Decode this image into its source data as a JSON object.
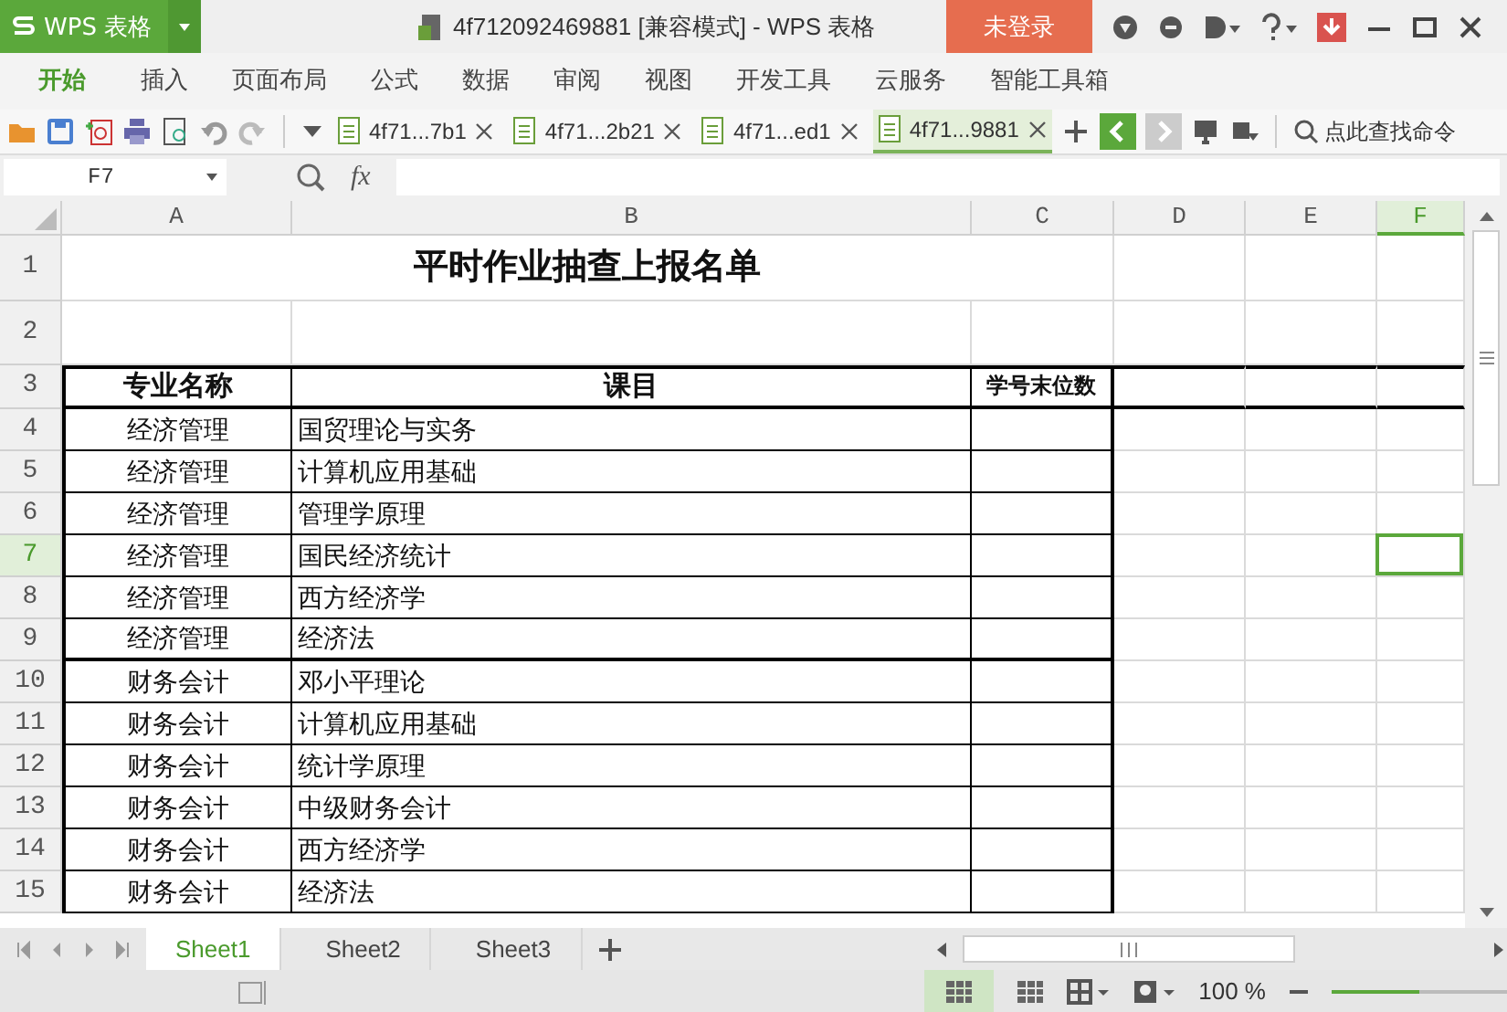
{
  "title_bar": {
    "app_name": "WPS 表格",
    "document_title": "4f712092469881 [兼容模式] - WPS 表格",
    "login_button": "未登录"
  },
  "menu_tabs": [
    {
      "label": "开始",
      "selected": true
    },
    {
      "label": "插入",
      "selected": false
    },
    {
      "label": "页面布局",
      "selected": false
    },
    {
      "label": "公式",
      "selected": false
    },
    {
      "label": "数据",
      "selected": false
    },
    {
      "label": "审阅",
      "selected": false
    },
    {
      "label": "视图",
      "selected": false
    },
    {
      "label": "开发工具",
      "selected": false
    },
    {
      "label": "云服务",
      "selected": false
    },
    {
      "label": "智能工具箱",
      "selected": false
    }
  ],
  "document_tabs": [
    {
      "label": "4f71...7b1",
      "selected": false
    },
    {
      "label": "4f71...2b21",
      "selected": false
    },
    {
      "label": "4f71...ed1",
      "selected": false
    },
    {
      "label": "4f71...9881",
      "selected": true
    }
  ],
  "command_search": {
    "placeholder": "点此查找命令"
  },
  "formula_bar": {
    "name_box": "F7",
    "fx_label": "fx"
  },
  "columns": [
    {
      "label": "A",
      "selected": false
    },
    {
      "label": "B",
      "selected": false
    },
    {
      "label": "C",
      "selected": false
    },
    {
      "label": "D",
      "selected": false
    },
    {
      "label": "E",
      "selected": false
    },
    {
      "label": "F",
      "selected": true
    }
  ],
  "rows": [
    {
      "number": "1",
      "kind": "title",
      "selected": false,
      "cells": [
        "平时作业抽查上报名单"
      ]
    },
    {
      "number": "2",
      "kind": "blank",
      "selected": false,
      "cells": []
    },
    {
      "number": "3",
      "kind": "header",
      "selected": false,
      "cells": [
        "专业名称",
        "课目",
        "学号末位数"
      ]
    },
    {
      "number": "4",
      "kind": "data",
      "selected": false,
      "group_end": false,
      "cells": [
        "经济管理",
        "国贸理论与实务"
      ]
    },
    {
      "number": "5",
      "kind": "data",
      "selected": false,
      "group_end": false,
      "cells": [
        "经济管理",
        "计算机应用基础"
      ]
    },
    {
      "number": "6",
      "kind": "data",
      "selected": false,
      "group_end": false,
      "cells": [
        "经济管理",
        "管理学原理"
      ]
    },
    {
      "number": "7",
      "kind": "data",
      "selected": true,
      "group_end": false,
      "cells": [
        "经济管理",
        "国民经济统计"
      ]
    },
    {
      "number": "8",
      "kind": "data",
      "selected": false,
      "group_end": false,
      "cells": [
        "经济管理",
        "西方经济学"
      ]
    },
    {
      "number": "9",
      "kind": "data",
      "selected": false,
      "group_end": true,
      "cells": [
        "经济管理",
        "经济法"
      ]
    },
    {
      "number": "10",
      "kind": "data",
      "selected": false,
      "group_end": false,
      "cells": [
        "财务会计",
        "邓小平理论"
      ]
    },
    {
      "number": "11",
      "kind": "data",
      "selected": false,
      "group_end": false,
      "cells": [
        "财务会计",
        "计算机应用基础"
      ]
    },
    {
      "number": "12",
      "kind": "data",
      "selected": false,
      "group_end": false,
      "cells": [
        "财务会计",
        "统计学原理"
      ]
    },
    {
      "number": "13",
      "kind": "data",
      "selected": false,
      "group_end": false,
      "cells": [
        "财务会计",
        "中级财务会计"
      ]
    },
    {
      "number": "14",
      "kind": "data",
      "selected": false,
      "group_end": false,
      "cells": [
        "财务会计",
        "西方经济学"
      ]
    },
    {
      "number": "15",
      "kind": "data",
      "selected": false,
      "group_end": false,
      "cells": [
        "财务会计",
        "经济法"
      ]
    }
  ],
  "sheet_tabs": [
    {
      "label": "Sheet1",
      "selected": true
    },
    {
      "label": "Sheet2",
      "selected": false
    },
    {
      "label": "Sheet3",
      "selected": false
    }
  ],
  "status_bar": {
    "zoom": "100 %",
    "zoom_slider": {
      "level": 0.5
    }
  }
}
